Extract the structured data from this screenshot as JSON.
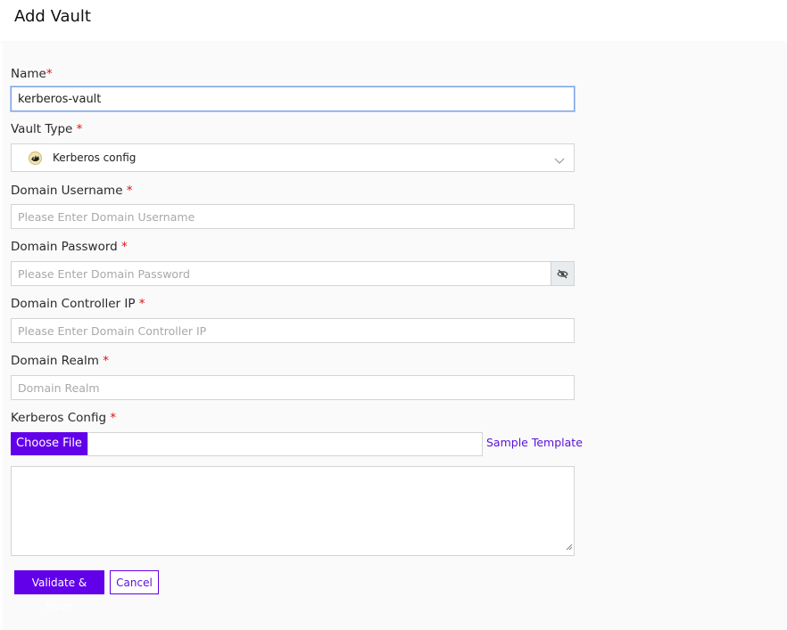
{
  "page": {
    "title": "Add Vault"
  },
  "colors": {
    "accent": "#6200ea",
    "required": "#dd1111"
  },
  "form": {
    "name": {
      "label": "Name",
      "required_mark": "*",
      "value": "kerberos-vault"
    },
    "vault_type": {
      "label": "Vault Type",
      "required_mark": "*",
      "selected": "Kerberos config",
      "icon": "kerberos-dog-icon"
    },
    "domain_username": {
      "label": "Domain Username",
      "required_mark": "*",
      "placeholder": "Please Enter Domain Username",
      "value": ""
    },
    "domain_password": {
      "label": "Domain Password",
      "required_mark": "*",
      "placeholder": "Please Enter Domain Password",
      "value": "",
      "toggle_icon": "eye-slash-icon"
    },
    "domain_controller_ip": {
      "label": "Domain Controller IP",
      "required_mark": "*",
      "placeholder": "Please Enter Domain Controller IP",
      "value": ""
    },
    "domain_realm": {
      "label": "Domain Realm",
      "required_mark": "*",
      "placeholder": "Domain Realm",
      "value": ""
    },
    "kerberos_config": {
      "label": "Kerberos Config",
      "required_mark": "*",
      "choose_file_label": "Choose File",
      "sample_template_label": "Sample Template",
      "content": ""
    }
  },
  "actions": {
    "save_label": "Validate & Save",
    "cancel_label": "Cancel"
  }
}
